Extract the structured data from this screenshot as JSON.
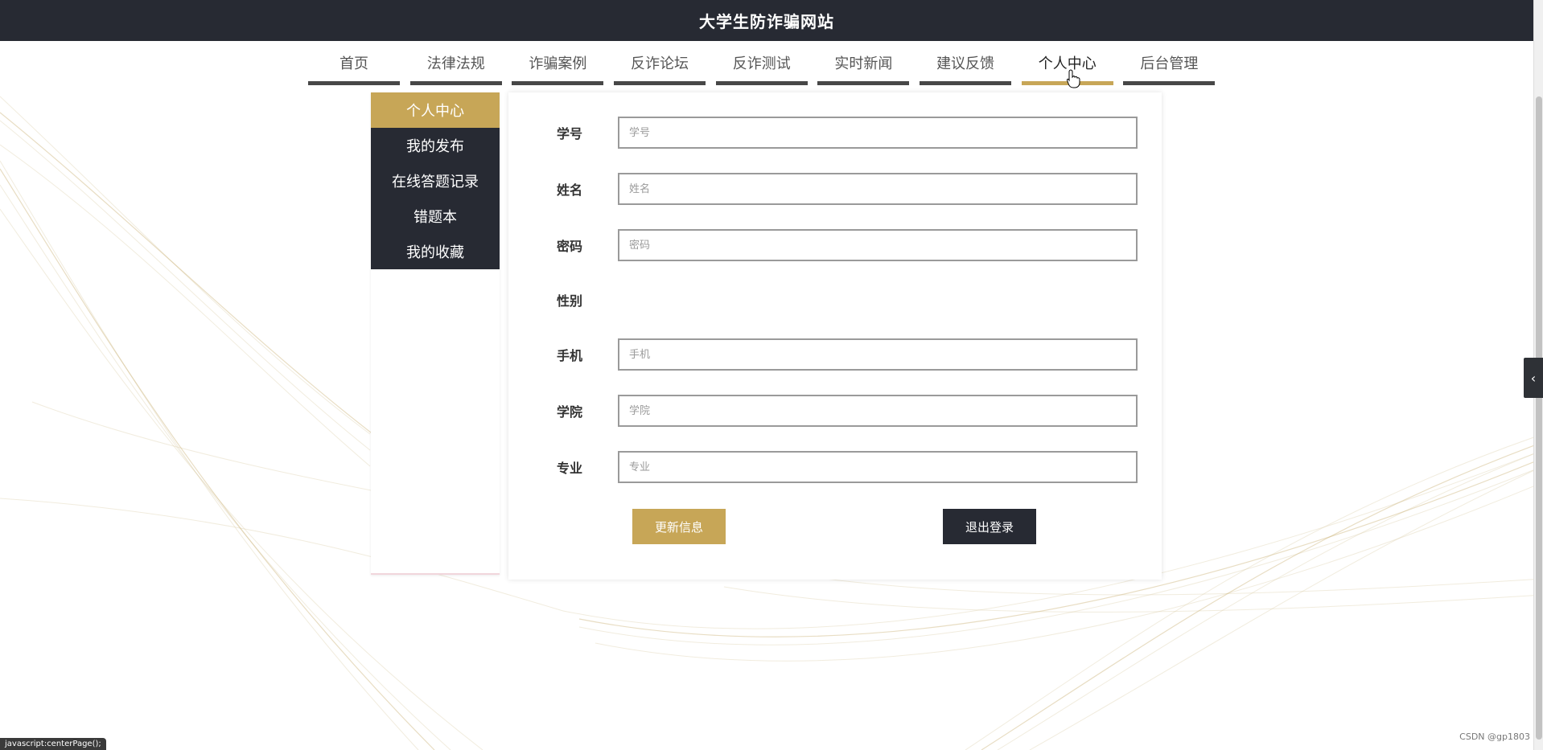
{
  "site": {
    "title": "大学生防诈骗网站"
  },
  "nav": {
    "items": [
      "首页",
      "法律法规",
      "诈骗案例",
      "反诈论坛",
      "反诈测试",
      "实时新闻",
      "建议反馈",
      "个人中心",
      "后台管理"
    ],
    "active_index": 7
  },
  "side_menu": {
    "items": [
      "个人中心",
      "我的发布",
      "在线答题记录",
      "错题本",
      "我的收藏"
    ],
    "active_index": 0
  },
  "form": {
    "student_id": {
      "label": "学号",
      "placeholder": "学号",
      "value": ""
    },
    "name": {
      "label": "姓名",
      "placeholder": "姓名",
      "value": ""
    },
    "password": {
      "label": "密码",
      "placeholder": "密码",
      "value": ""
    },
    "gender": {
      "label": "性别",
      "value": ""
    },
    "phone": {
      "label": "手机",
      "placeholder": "手机",
      "value": ""
    },
    "college": {
      "label": "学院",
      "placeholder": "学院",
      "value": ""
    },
    "major": {
      "label": "专业",
      "placeholder": "专业",
      "value": ""
    },
    "update_button": "更新信息",
    "logout_button": "退出登录"
  },
  "status_bar": {
    "text": "javascript:centerPage();"
  },
  "watermark": "CSDN @gp1803",
  "colors": {
    "header": "#272a33",
    "accent": "#c7a657",
    "nav_underline": "#474747"
  }
}
